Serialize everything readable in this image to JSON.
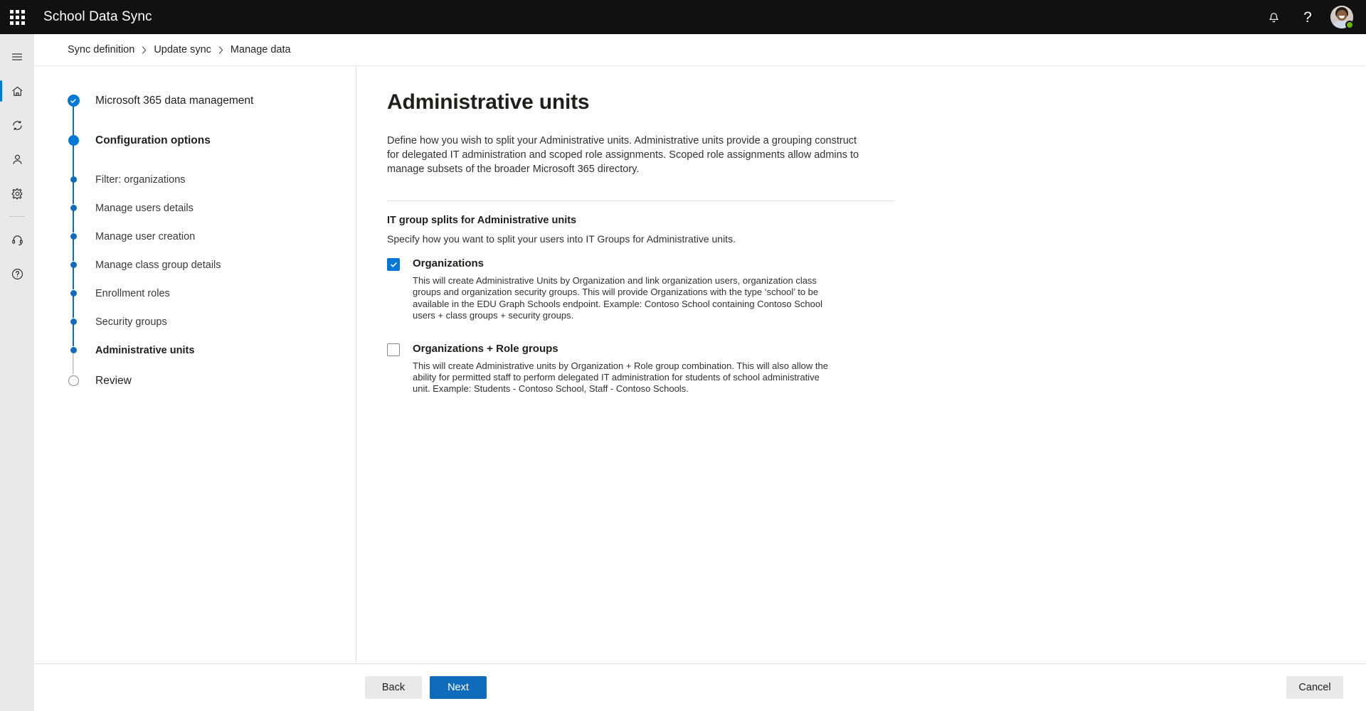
{
  "suitebar": {
    "waffle_icon": "app-launcher-waffle-icon",
    "title": "School Data Sync",
    "notification_icon": "bell-icon",
    "help_icon": "question-mark-icon",
    "avatar_name": "user-avatar",
    "presence": "available",
    "presence_color": "#6BB700",
    "background": "#111111"
  },
  "rail": {
    "items": [
      {
        "icon": "hamburger-menu-icon",
        "name": "nav-toggle",
        "active": false
      },
      {
        "icon": "home-icon",
        "name": "home",
        "active": true
      },
      {
        "icon": "sync-refresh-icon",
        "name": "sync",
        "active": false
      },
      {
        "icon": "person-icon",
        "name": "users",
        "active": false
      },
      {
        "icon": "gear-icon",
        "name": "settings",
        "active": false
      },
      {
        "icon": "divider",
        "name": "divider",
        "active": false
      },
      {
        "icon": "headset-icon",
        "name": "support",
        "active": false
      },
      {
        "icon": "question-circle-icon",
        "name": "help",
        "active": false
      }
    ],
    "active_indicator_color": "#0078d4",
    "background": "#e9e9e9"
  },
  "breadcrumb": {
    "items": [
      "Sync definition",
      "Update sync",
      "Manage data"
    ],
    "separator": "›"
  },
  "steps": {
    "items": [
      {
        "label": "Microsoft 365 data management",
        "state": "complete",
        "style": "big"
      },
      {
        "label": "Configuration options",
        "state": "current",
        "style": "bold"
      },
      {
        "label": "Filter: organizations",
        "state": "substep",
        "style": "normal"
      },
      {
        "label": "Manage users details",
        "state": "substep",
        "style": "normal"
      },
      {
        "label": "Manage user creation",
        "state": "substep",
        "style": "normal"
      },
      {
        "label": "Manage class group details",
        "state": "substep",
        "style": "normal"
      },
      {
        "label": "Enrollment roles",
        "state": "substep",
        "style": "normal"
      },
      {
        "label": "Security groups",
        "state": "substep",
        "style": "normal"
      },
      {
        "label": "Administrative units",
        "state": "substep-active",
        "style": "bold"
      },
      {
        "label": "Review",
        "state": "pending",
        "style": "big"
      }
    ],
    "accent_color": "#0f6cbd",
    "pending_color": "#8a8886"
  },
  "page": {
    "title": "Administrative units",
    "description": "Define how you wish to split your Administrative units. Administrative units provide a grouping construct for delegated IT administration and scoped role assignments. Scoped role assignments allow admins to manage subsets of the broader Microsoft 365 directory.",
    "section_title": "IT group splits for Administrative units",
    "section_subtitle": "Specify how you want to split your users into IT Groups for Administrative units.",
    "options": [
      {
        "label": "Organizations",
        "checked": true,
        "description": "This will create Administrative Units by Organization and link organization users, organization class groups and organization security groups. This will provide Organizations with the type ‘school’ to be available in the EDU Graph Schools endpoint. Example: Contoso School containing Contoso School users + class groups + security groups."
      },
      {
        "label": "Organizations + Role groups",
        "checked": false,
        "description": "This will create Administrative units by Organization + Role group combination. This will also allow the ability for permitted staff to perform delegated IT administration for students of school administrative unit. Example: Students - Contoso School, Staff - Contoso Schools."
      }
    ]
  },
  "footer": {
    "back_label": "Back",
    "next_label": "Next",
    "cancel_label": "Cancel",
    "primary_color": "#0f6cbd"
  }
}
